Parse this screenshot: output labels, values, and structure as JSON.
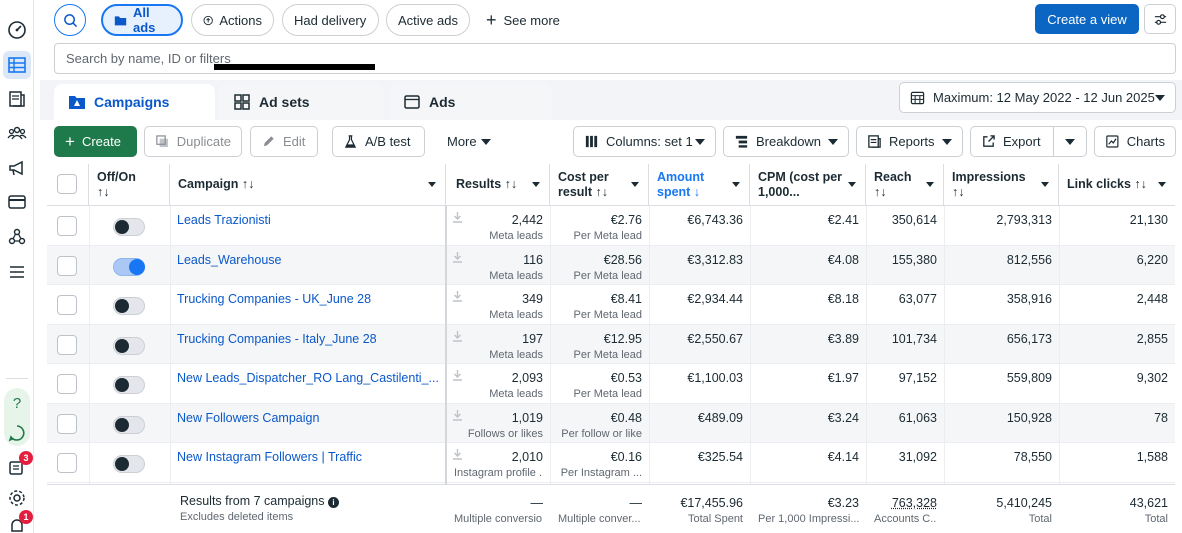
{
  "filters": {
    "all_ads": "All ads",
    "actions": "Actions",
    "had_delivery": "Had delivery",
    "active_ads": "Active ads",
    "see_more": "See more",
    "create_view": "Create a view"
  },
  "search": {
    "placeholder": "Search by name, ID or filters"
  },
  "tabs": {
    "campaigns": "Campaigns",
    "ad_sets": "Ad sets",
    "ads": "Ads"
  },
  "date_range": "Maximum: 12 May 2022 - 12 Jun 2025",
  "toolbar": {
    "create": "Create",
    "duplicate": "Duplicate",
    "edit": "Edit",
    "ab_test": "A/B test",
    "more": "More",
    "columns": "Columns: set 1",
    "breakdown": "Breakdown",
    "reports": "Reports",
    "export": "Export",
    "charts": "Charts"
  },
  "columns": {
    "off_on": "Off/On",
    "off_on_sort": "↑↓",
    "campaign": "Campaign ↑↓",
    "results": "Results ↑↓",
    "cost_per_result_1": "Cost per",
    "cost_per_result_2": "result ↑↓",
    "amount_spent_1": "Amount",
    "amount_spent_2": "spent ↓",
    "cpm_1": "CPM (cost per",
    "cpm_2": "1,000...",
    "reach_1": "Reach",
    "reach_2": "↑↓",
    "impressions_1": "Impressions",
    "impressions_2": "↑↓",
    "link_clicks": "Link clicks ↑↓"
  },
  "rows": [
    {
      "on": false,
      "name": "Leads Trazionisti",
      "results": "2,442",
      "results_sub": "Meta leads",
      "cost": "€2.76",
      "cost_sub": "Per Meta lead",
      "spent": "€6,743.36",
      "cpm": "€2.41",
      "reach": "350,614",
      "impressions": "2,793,313",
      "clicks": "21,130"
    },
    {
      "on": true,
      "name": "Leads_Warehouse",
      "results": "116",
      "results_sub": "Meta leads",
      "cost": "€28.56",
      "cost_sub": "Per Meta lead",
      "spent": "€3,312.83",
      "cpm": "€4.08",
      "reach": "155,380",
      "impressions": "812,556",
      "clicks": "6,220"
    },
    {
      "on": false,
      "name": "Trucking Companies - UK_June 28",
      "results": "349",
      "results_sub": "Meta leads",
      "cost": "€8.41",
      "cost_sub": "Per Meta lead",
      "spent": "€2,934.44",
      "cpm": "€8.18",
      "reach": "63,077",
      "impressions": "358,916",
      "clicks": "2,448"
    },
    {
      "on": false,
      "name": "Trucking Companies - Italy_June 28",
      "results": "197",
      "results_sub": "Meta leads",
      "cost": "€12.95",
      "cost_sub": "Per Meta lead",
      "spent": "€2,550.67",
      "cpm": "€3.89",
      "reach": "101,734",
      "impressions": "656,173",
      "clicks": "2,855"
    },
    {
      "on": false,
      "name": "New Leads_Dispatcher_RO Lang_Castilenti_...",
      "results": "2,093",
      "results_sub": "Meta leads",
      "cost": "€0.53",
      "cost_sub": "Per Meta lead",
      "spent": "€1,100.03",
      "cpm": "€1.97",
      "reach": "97,152",
      "impressions": "559,809",
      "clicks": "9,302"
    },
    {
      "on": false,
      "name": "New Followers Campaign",
      "results": "1,019",
      "results_sub": "Follows or likes",
      "cost": "€0.48",
      "cost_sub": "Per follow or like",
      "spent": "€489.09",
      "cpm": "€3.24",
      "reach": "61,063",
      "impressions": "150,928",
      "clicks": "78"
    },
    {
      "on": false,
      "name": "New Instagram Followers | Traffic",
      "results": "2,010",
      "results_sub": "Instagram profile ...",
      "cost": "€0.16",
      "cost_sub": "Per Instagram ...",
      "spent": "€325.54",
      "cpm": "€4.14",
      "reach": "31,092",
      "impressions": "78,550",
      "clicks": "1,588"
    }
  ],
  "footer": {
    "title": "Results from 7 campaigns",
    "subtitle": "Excludes deleted items",
    "results": "—",
    "results_sub": "Multiple conversio...",
    "cost": "—",
    "cost_sub": "Multiple conver...",
    "spent": "€17,455.96",
    "spent_sub": "Total Spent",
    "cpm": "€3.23",
    "cpm_sub": "Per 1,000 Impressi...",
    "reach": "763,328",
    "reach_sub": "Accounts C...",
    "impressions": "5,410,245",
    "impressions_sub": "Total",
    "clicks": "43,621",
    "clicks_sub": "Total"
  },
  "badges": {
    "notifications": "3",
    "alerts": "1"
  },
  "colors": {
    "primary": "#0a66c2",
    "create": "#1e7a4a",
    "link": "#0a58ca",
    "active_toggle": "#1877f2"
  }
}
